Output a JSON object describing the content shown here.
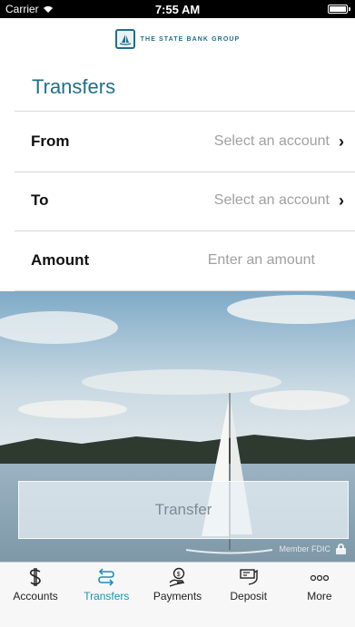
{
  "status_bar": {
    "carrier": "Carrier",
    "time": "7:55 AM"
  },
  "header": {
    "logo_text": "THE STATE BANK GROUP"
  },
  "page": {
    "title": "Transfers"
  },
  "form": {
    "from": {
      "label": "From",
      "value": "Select an account"
    },
    "to": {
      "label": "To",
      "value": "Select an account"
    },
    "amount": {
      "label": "Amount",
      "placeholder": "Enter an amount"
    }
  },
  "actions": {
    "transfer_label": "Transfer"
  },
  "footer": {
    "fdic_text": "Member FDIC"
  },
  "tabs": [
    {
      "label": "Accounts",
      "icon": "dollar-icon"
    },
    {
      "label": "Transfers",
      "icon": "transfer-arrows-icon",
      "active": true
    },
    {
      "label": "Payments",
      "icon": "payment-hand-icon"
    },
    {
      "label": "Deposit",
      "icon": "check-deposit-icon"
    },
    {
      "label": "More",
      "icon": "more-dots-icon"
    }
  ],
  "colors": {
    "accent": "#1f6f8a",
    "tab_active": "#1f8fb5"
  }
}
